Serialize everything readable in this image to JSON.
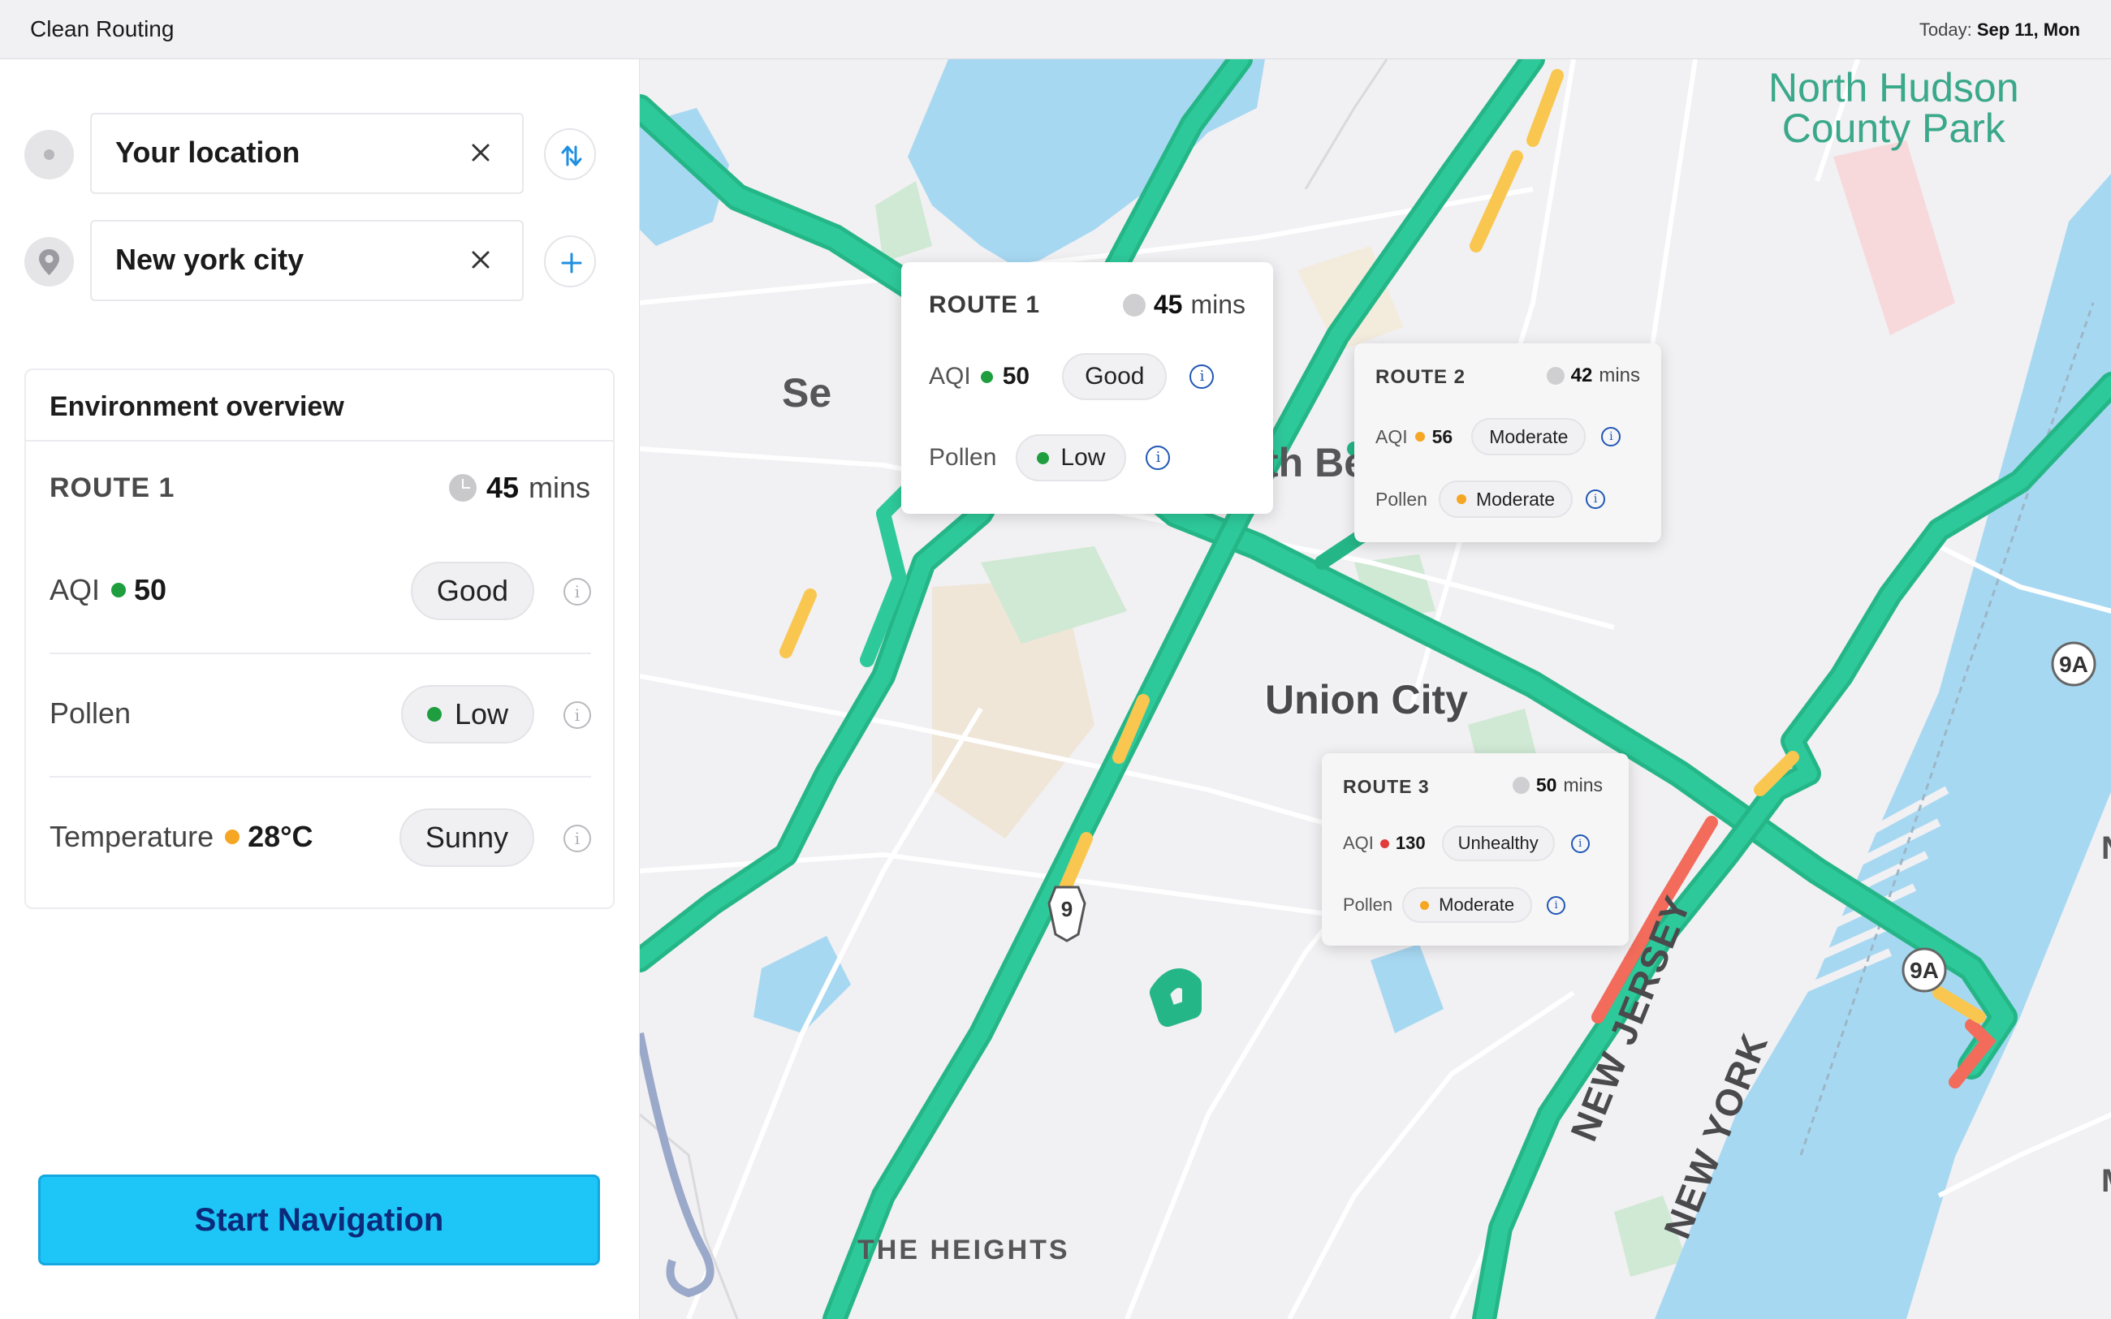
{
  "app": {
    "title": "Clean Routing",
    "today_label": "Today:",
    "today_value": "Sep 11, Mon"
  },
  "search": {
    "origin": {
      "value": "Your location",
      "icon": "current-location-icon"
    },
    "destination": {
      "value": "New york city",
      "icon": "map-pin-icon"
    },
    "swap_icon": "swap-icon",
    "add_icon": "plus-icon",
    "clear_icon": "close-icon"
  },
  "environment": {
    "title": "Environment overview",
    "route": "ROUTE 1",
    "time_value": "45",
    "time_unit": "mins",
    "rows": [
      {
        "label": "AQI",
        "value": "50",
        "dot_color": "#1e9e3e",
        "pill": "Good",
        "pill_dot_color": ""
      },
      {
        "label": "Pollen",
        "value": "",
        "dot_color": "",
        "pill": "Low",
        "pill_dot_color": "#1e9e3e"
      },
      {
        "label": "Temperature",
        "value": "28°C",
        "dot_color": "#f5a623",
        "pill": "Sunny",
        "pill_dot_color": ""
      }
    ]
  },
  "start_button": "Start Navigation",
  "map": {
    "labels": {
      "north_hudson": "North Hudson",
      "county_park": "County Park",
      "union_city": "Union City",
      "the_heights": "THE HEIGHTS",
      "new_jersey": "NEW JERSEY",
      "new_york": "NEW YORK",
      "se": "Se",
      "th_be": "th Be",
      "route_9": "9",
      "route_9a_1": "9A",
      "route_9a_2": "9A",
      "edge_n": "N",
      "edge_m": "M"
    },
    "colors": {
      "water": "#a7d8f2",
      "route_green": "#2ec99a",
      "route_yellow": "#f9c74f",
      "route_red": "#f26b5b"
    }
  },
  "routes": [
    {
      "name": "ROUTE 1",
      "time_value": "45",
      "time_unit": "mins",
      "aqi_label": "AQI",
      "aqi_value": "50",
      "aqi_color": "#1e9e3e",
      "aqi_pill": "Good",
      "pollen_label": "Pollen",
      "pollen_pill": "Low",
      "pollen_color": "#1e9e3e"
    },
    {
      "name": "ROUTE 2",
      "time_value": "42",
      "time_unit": "mins",
      "aqi_label": "AQI",
      "aqi_value": "56",
      "aqi_color": "#f5a623",
      "aqi_pill": "Moderate",
      "pollen_label": "Pollen",
      "pollen_pill": "Moderate",
      "pollen_color": "#f5a623"
    },
    {
      "name": "ROUTE 3",
      "time_value": "50",
      "time_unit": "mins",
      "aqi_label": "AQI",
      "aqi_value": "130",
      "aqi_color": "#e23b3b",
      "aqi_pill": "Unhealthy",
      "pollen_label": "Pollen",
      "pollen_pill": "Moderate",
      "pollen_color": "#f5a623"
    }
  ]
}
